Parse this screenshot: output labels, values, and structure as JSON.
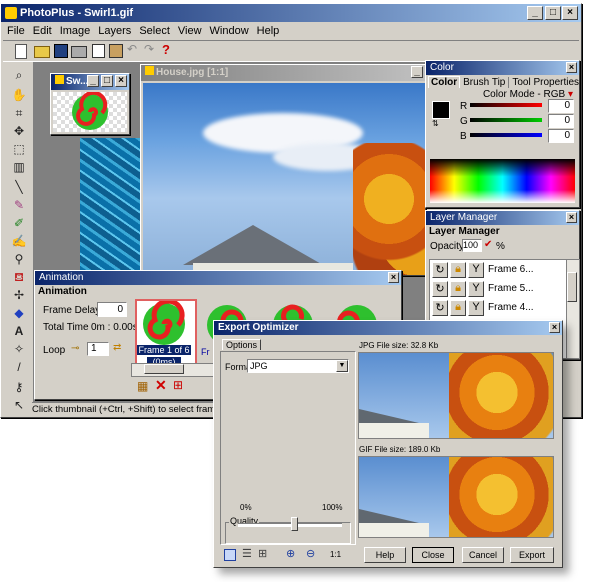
{
  "app": {
    "title": "PhotoPlus - Swirl1.gif",
    "menus": [
      "File",
      "Edit",
      "Image",
      "Layers",
      "Select",
      "View",
      "Window",
      "Help"
    ]
  },
  "doc_small": {
    "title": "Sw..."
  },
  "doc_main": {
    "title": "House.jpg [1:1]"
  },
  "color_panel": {
    "title": "Color",
    "tabs": [
      "Color",
      "Brush Tip",
      "Tool Properties"
    ],
    "mode": "Color Mode - RGB",
    "r_label": "R",
    "g_label": "G",
    "b_label": "B",
    "r": "0",
    "g": "0",
    "b": "0"
  },
  "layer_panel": {
    "title": "Layer Manager",
    "tab": "Layer Manager",
    "opacity_label": "Opacity:",
    "opacity": "100",
    "pct": "%",
    "layers": [
      "Frame 6...",
      "Frame 5...",
      "Frame 4..."
    ]
  },
  "animation": {
    "title": "Animation",
    "tab": "Animation",
    "frame_delay_label": "Frame Delay",
    "frame_delay": "0",
    "total_time_label": "Total Time",
    "total_time": "0m : 0.00s",
    "loop_label": "Loop",
    "loop": "1",
    "frame1_label": "Frame 1 of 6",
    "frame1_time": "(0ms)",
    "frame2_label_partial": "Fr"
  },
  "statusbar": {
    "text": "Click thumbnail (+Ctrl, +Shift) to select frame(s); drag"
  },
  "export": {
    "title": "Export Optimizer",
    "options_tab": "Options",
    "format_label": "Format:",
    "format": "JPG",
    "quality_label": "Quality",
    "q_min": "0%",
    "q_max": "100%",
    "jpg_size": "JPG File size:  32.8 Kb",
    "gif_size": "GIF File size: 189.0 Kb",
    "zoom": "1:1",
    "quality_value": 0.55,
    "buttons": {
      "help": "Help",
      "close": "Close",
      "cancel": "Cancel",
      "export": "Export"
    }
  }
}
